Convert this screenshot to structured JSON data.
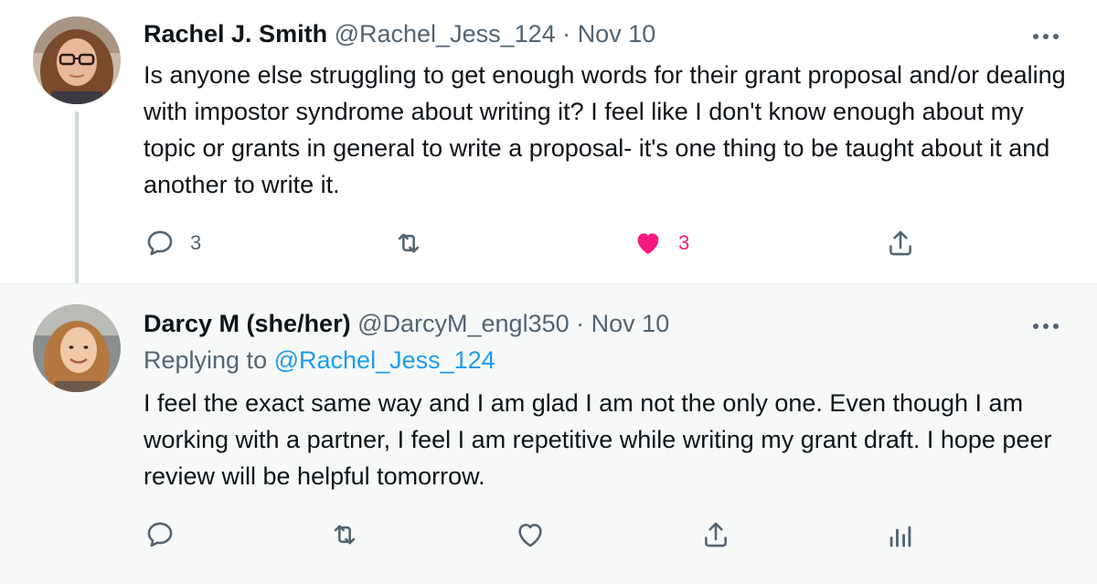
{
  "tweets": [
    {
      "author_name": "Rachel J. Smith",
      "handle": "@Rachel_Jess_124",
      "separator": "·",
      "date": "Nov 10",
      "text": "Is anyone else struggling to get enough words for their grant proposal and/or dealing with impostor syndrome about writing it? I feel like I don't know enough about my topic or grants in general to write a proposal- it's one thing to be taught about it and another to write it.",
      "reply_count": "3",
      "like_count": "3",
      "liked": true,
      "icons": [
        "reply-icon",
        "retweet-icon",
        "like-icon",
        "share-icon",
        "more-icon"
      ]
    },
    {
      "author_name": "Darcy M (she/her)",
      "handle": "@DarcyM_engl350",
      "separator": "·",
      "date": "Nov 10",
      "replying_prefix": "Replying to",
      "replying_to": "@Rachel_Jess_124",
      "text": "I feel the exact same way and I am glad I am not the only one. Even though I am working with a partner, I feel I am repetitive while writing my grant draft. I hope peer review will be helpful tomorrow.",
      "liked": false,
      "icons": [
        "reply-icon",
        "retweet-icon",
        "like-icon",
        "share-icon",
        "analytics-icon",
        "more-icon"
      ]
    }
  ],
  "colors": {
    "text": "#0f1419",
    "secondary": "#536471",
    "link": "#1d9bf0",
    "like": "#f91880",
    "thread_line": "#cfd9de",
    "reply_background": "#f7f9f9"
  }
}
